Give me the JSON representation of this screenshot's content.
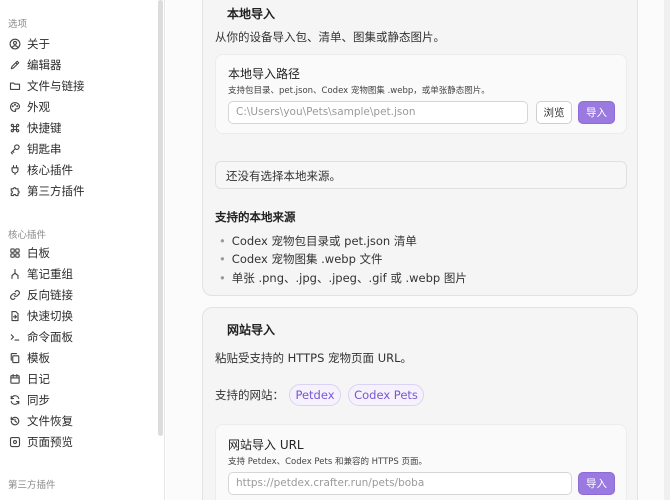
{
  "sidebar": {
    "section_options": "选项",
    "section_core": "核心插件",
    "section_third": "第三方插件",
    "options_items": [
      {
        "label": "关于",
        "icon": "user-circle-icon"
      },
      {
        "label": "编辑器",
        "icon": "pencil-icon"
      },
      {
        "label": "文件与链接",
        "icon": "folder-icon"
      },
      {
        "label": "外观",
        "icon": "palette-icon"
      },
      {
        "label": "快捷键",
        "icon": "command-icon"
      },
      {
        "label": "钥匙串",
        "icon": "key-icon"
      },
      {
        "label": "核心插件",
        "icon": "plug-icon"
      },
      {
        "label": "第三方插件",
        "icon": "puzzle-icon"
      }
    ],
    "core_items": [
      {
        "label": "白板",
        "icon": "grid-icon"
      },
      {
        "label": "笔记重组",
        "icon": "merge-icon"
      },
      {
        "label": "反向链接",
        "icon": "link-icon"
      },
      {
        "label": "快速切换",
        "icon": "file-switch-icon"
      },
      {
        "label": "命令面板",
        "icon": "terminal-icon"
      },
      {
        "label": "模板",
        "icon": "copy-icon"
      },
      {
        "label": "日记",
        "icon": "calendar-icon"
      },
      {
        "label": "同步",
        "icon": "sync-icon"
      },
      {
        "label": "文件恢复",
        "icon": "history-icon"
      },
      {
        "label": "页面预览",
        "icon": "preview-icon"
      }
    ]
  },
  "local": {
    "title": "本地导入",
    "desc": "从你的设备导入包、清单、图集或静态图片。",
    "path_label": "本地导入路径",
    "path_sub": "支持包目录、pet.json、Codex 宠物图集 .webp，或单张静态图片。",
    "path_placeholder": "C:\\Users\\you\\Pets\\sample\\pet.json",
    "browse": "浏览",
    "import": "导入",
    "status": "还没有选择本地来源。",
    "supported_title": "支持的本地来源",
    "supported": [
      "Codex 宠物包目录或 pet.json 清单",
      "Codex 宠物图集 .webp 文件",
      "单张 .png、.jpg、.jpeg、.gif 或 .webp 图片"
    ]
  },
  "web": {
    "title": "网站导入",
    "desc": "粘贴受支持的 HTTPS 宠物页面 URL。",
    "sites_label": "支持的网站：",
    "sites": [
      "Petdex",
      "Codex Pets"
    ],
    "url_label": "网站导入 URL",
    "url_sub": "支持 Petdex、Codex Pets 和兼容的 HTTPS 页面。",
    "url_placeholder": "https://petdex.crafter.run/pets/boba",
    "import": "导入"
  },
  "colors": {
    "accent": "#9a7ae0",
    "chip_text": "#7a55d2"
  }
}
